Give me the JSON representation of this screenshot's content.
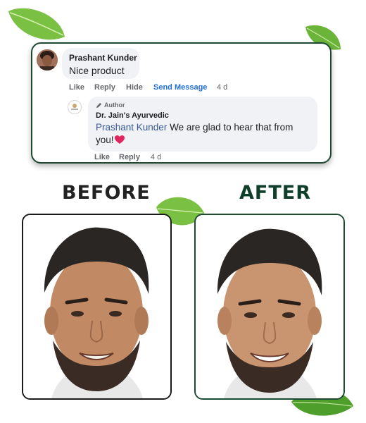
{
  "colors": {
    "leaf": "#7ac143",
    "card_border": "#1e4a34",
    "link_blue": "#216fdb",
    "heading_dark": "#222222",
    "heading_green": "#0f3f2b",
    "heart": "#e0245e"
  },
  "comment": {
    "author": "Prashant Kunder",
    "text": "Nice product",
    "actions": {
      "like": "Like",
      "reply": "Reply",
      "hide": "Hide",
      "send_message": "Send Message",
      "time": "4 d"
    }
  },
  "reply": {
    "badge": "Author",
    "author": "Dr. Jain's Ayurvedic",
    "mention": "Prashant Kunder",
    "text": " We are glad to hear that from you!",
    "emoji": "heart",
    "actions": {
      "like": "Like",
      "reply": "Reply",
      "time": "4 d"
    }
  },
  "comparison": {
    "before_label": "BEFORE",
    "after_label": "AFTER"
  }
}
